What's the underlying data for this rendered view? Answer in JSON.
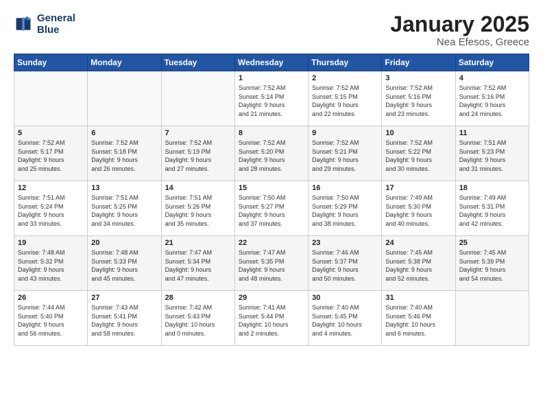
{
  "logo": {
    "line1": "General",
    "line2": "Blue"
  },
  "title": "January 2025",
  "subtitle": "Nea Efesos, Greece",
  "headers": [
    "Sunday",
    "Monday",
    "Tuesday",
    "Wednesday",
    "Thursday",
    "Friday",
    "Saturday"
  ],
  "weeks": [
    [
      {
        "day": "",
        "info": ""
      },
      {
        "day": "",
        "info": ""
      },
      {
        "day": "",
        "info": ""
      },
      {
        "day": "1",
        "info": "Sunrise: 7:52 AM\nSunset: 5:14 PM\nDaylight: 9 hours\nand 21 minutes."
      },
      {
        "day": "2",
        "info": "Sunrise: 7:52 AM\nSunset: 5:15 PM\nDaylight: 9 hours\nand 22 minutes."
      },
      {
        "day": "3",
        "info": "Sunrise: 7:52 AM\nSunset: 5:16 PM\nDaylight: 9 hours\nand 23 minutes."
      },
      {
        "day": "4",
        "info": "Sunrise: 7:52 AM\nSunset: 5:16 PM\nDaylight: 9 hours\nand 24 minutes."
      }
    ],
    [
      {
        "day": "5",
        "info": "Sunrise: 7:52 AM\nSunset: 5:17 PM\nDaylight: 9 hours\nand 25 minutes."
      },
      {
        "day": "6",
        "info": "Sunrise: 7:52 AM\nSunset: 5:18 PM\nDaylight: 9 hours\nand 26 minutes."
      },
      {
        "day": "7",
        "info": "Sunrise: 7:52 AM\nSunset: 5:19 PM\nDaylight: 9 hours\nand 27 minutes."
      },
      {
        "day": "8",
        "info": "Sunrise: 7:52 AM\nSunset: 5:20 PM\nDaylight: 9 hours\nand 28 minutes."
      },
      {
        "day": "9",
        "info": "Sunrise: 7:52 AM\nSunset: 5:21 PM\nDaylight: 9 hours\nand 29 minutes."
      },
      {
        "day": "10",
        "info": "Sunrise: 7:52 AM\nSunset: 5:22 PM\nDaylight: 9 hours\nand 30 minutes."
      },
      {
        "day": "11",
        "info": "Sunrise: 7:51 AM\nSunset: 5:23 PM\nDaylight: 9 hours\nand 31 minutes."
      }
    ],
    [
      {
        "day": "12",
        "info": "Sunrise: 7:51 AM\nSunset: 5:24 PM\nDaylight: 9 hours\nand 33 minutes."
      },
      {
        "day": "13",
        "info": "Sunrise: 7:51 AM\nSunset: 5:25 PM\nDaylight: 9 hours\nand 34 minutes."
      },
      {
        "day": "14",
        "info": "Sunrise: 7:51 AM\nSunset: 5:26 PM\nDaylight: 9 hours\nand 35 minutes."
      },
      {
        "day": "15",
        "info": "Sunrise: 7:50 AM\nSunset: 5:27 PM\nDaylight: 9 hours\nand 37 minutes."
      },
      {
        "day": "16",
        "info": "Sunrise: 7:50 AM\nSunset: 5:29 PM\nDaylight: 9 hours\nand 38 minutes."
      },
      {
        "day": "17",
        "info": "Sunrise: 7:49 AM\nSunset: 5:30 PM\nDaylight: 9 hours\nand 40 minutes."
      },
      {
        "day": "18",
        "info": "Sunrise: 7:49 AM\nSunset: 5:31 PM\nDaylight: 9 hours\nand 42 minutes."
      }
    ],
    [
      {
        "day": "19",
        "info": "Sunrise: 7:48 AM\nSunset: 5:32 PM\nDaylight: 9 hours\nand 43 minutes."
      },
      {
        "day": "20",
        "info": "Sunrise: 7:48 AM\nSunset: 5:33 PM\nDaylight: 9 hours\nand 45 minutes."
      },
      {
        "day": "21",
        "info": "Sunrise: 7:47 AM\nSunset: 5:34 PM\nDaylight: 9 hours\nand 47 minutes."
      },
      {
        "day": "22",
        "info": "Sunrise: 7:47 AM\nSunset: 5:35 PM\nDaylight: 9 hours\nand 48 minutes."
      },
      {
        "day": "23",
        "info": "Sunrise: 7:46 AM\nSunset: 5:37 PM\nDaylight: 9 hours\nand 50 minutes."
      },
      {
        "day": "24",
        "info": "Sunrise: 7:45 AM\nSunset: 5:38 PM\nDaylight: 9 hours\nand 52 minutes."
      },
      {
        "day": "25",
        "info": "Sunrise: 7:45 AM\nSunset: 5:39 PM\nDaylight: 9 hours\nand 54 minutes."
      }
    ],
    [
      {
        "day": "26",
        "info": "Sunrise: 7:44 AM\nSunset: 5:40 PM\nDaylight: 9 hours\nand 56 minutes."
      },
      {
        "day": "27",
        "info": "Sunrise: 7:43 AM\nSunset: 5:41 PM\nDaylight: 9 hours\nand 58 minutes."
      },
      {
        "day": "28",
        "info": "Sunrise: 7:42 AM\nSunset: 5:43 PM\nDaylight: 10 hours\nand 0 minutes."
      },
      {
        "day": "29",
        "info": "Sunrise: 7:41 AM\nSunset: 5:44 PM\nDaylight: 10 hours\nand 2 minutes."
      },
      {
        "day": "30",
        "info": "Sunrise: 7:40 AM\nSunset: 5:45 PM\nDaylight: 10 hours\nand 4 minutes."
      },
      {
        "day": "31",
        "info": "Sunrise: 7:40 AM\nSunset: 5:46 PM\nDaylight: 10 hours\nand 6 minutes."
      },
      {
        "day": "",
        "info": ""
      }
    ]
  ]
}
